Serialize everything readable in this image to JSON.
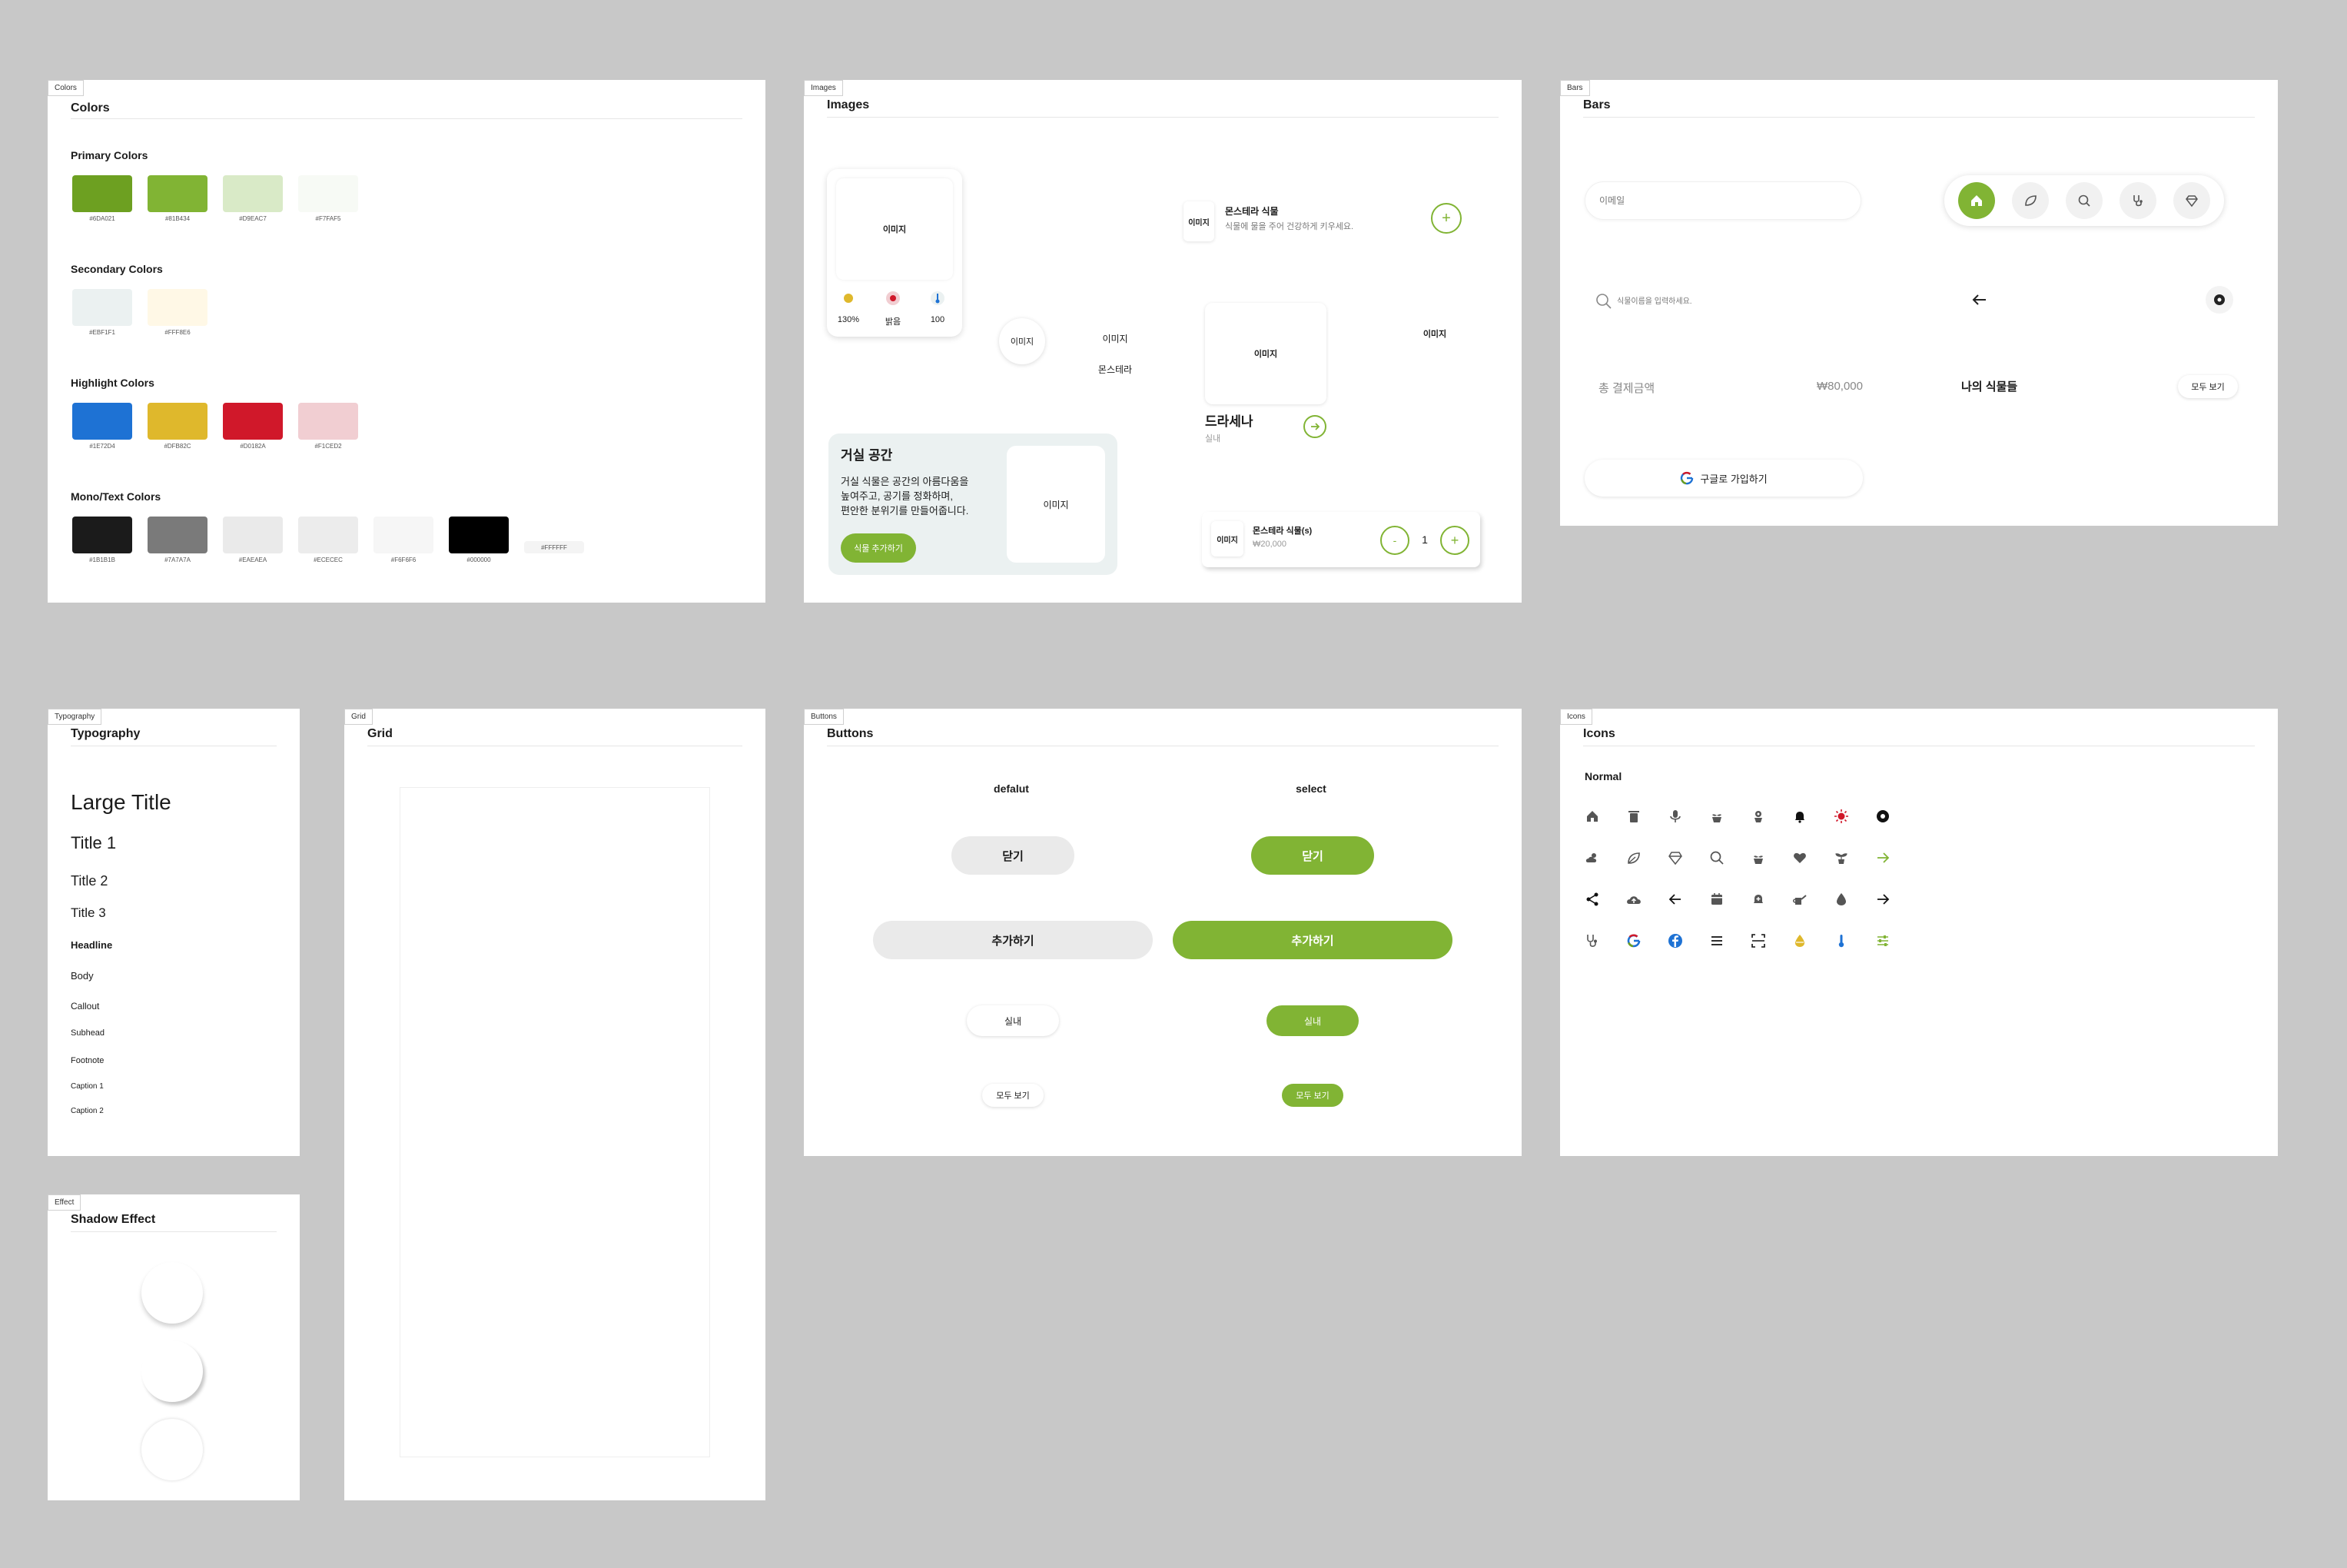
{
  "colors_frame": {
    "tag": "Colors",
    "title": "Colors",
    "groups": [
      {
        "title": "Primary Colors",
        "swatches": [
          {
            "hex": "#6DA021",
            "label": "#6DA021"
          },
          {
            "hex": "#81B434",
            "label": "#81B434"
          },
          {
            "hex": "#D9EAC7",
            "label": "#D9EAC7"
          },
          {
            "hex": "#F7FAF5",
            "label": "#F7FAF5"
          }
        ]
      },
      {
        "title": "Secondary Colors",
        "swatches": [
          {
            "hex": "#EBF1F1",
            "label": "#EBF1F1"
          },
          {
            "hex": "#FFF8E6",
            "label": "#FFF8E6"
          }
        ]
      },
      {
        "title": "Highlight Colors",
        "swatches": [
          {
            "hex": "#1E72D4",
            "label": "#1E72D4"
          },
          {
            "hex": "#DFB82C",
            "label": "#DFB82C"
          },
          {
            "hex": "#D0182A",
            "label": "#D0182A"
          },
          {
            "hex": "#F1CED2",
            "label": "#F1CED2"
          }
        ]
      },
      {
        "title": "Mono/Text Colors",
        "swatches": [
          {
            "hex": "#1B1B1B",
            "label": "#1B1B1B"
          },
          {
            "hex": "#7A7A7A",
            "label": "#7A7A7A"
          },
          {
            "hex": "#EAEAEA",
            "label": "#EAEAEA"
          },
          {
            "hex": "#ECECEC",
            "label": "#ECECEC"
          },
          {
            "hex": "#F6F6F6",
            "label": "#F6F6F6"
          },
          {
            "hex": "#000000",
            "label": "#000000"
          },
          {
            "hex": "#FFFFFF",
            "label": "#FFFFFF"
          }
        ]
      }
    ]
  },
  "images_frame": {
    "tag": "Images",
    "title": "Images",
    "plant_card": {
      "image_label": "이미지",
      "stats": [
        {
          "icon": "sun-icon",
          "value": "130%"
        },
        {
          "icon": "light-icon",
          "value": "밝음"
        },
        {
          "icon": "thermometer-icon",
          "value": "100"
        }
      ]
    },
    "circle_image": "이미지",
    "small_image": "이미지",
    "small_caption": "몬스테라",
    "list_item": {
      "image": "이미지",
      "title": "몬스테라 식물",
      "subtitle": "식물에 물을 주어 건강하게 키우세요."
    },
    "product": {
      "image": "이미지",
      "name": "드라세나",
      "category": "실내"
    },
    "right_image": "이미지",
    "room_card": {
      "title": "거실 공간",
      "desc1": "거실 식물은 공간의 아름다움을",
      "desc2": "높여주고, 공기를 정화하며,",
      "desc3": "편안한 분위기를 만들어줍니다.",
      "button": "식물 추가하기",
      "image": "이미지"
    },
    "cart_item": {
      "image": "이미지",
      "title": "몬스테라 식물(s)",
      "price": "₩20,000",
      "minus": "-",
      "qty": "1",
      "plus": "+"
    }
  },
  "bars_frame": {
    "tag": "Bars",
    "title": "Bars",
    "email_placeholder": "이메일",
    "search_placeholder": "식물이름을 입력하세요.",
    "total_label": "총 결제금액",
    "total_value": "₩80,000",
    "my_plants": "나의 식물들",
    "view_all": "모두 보기",
    "google_signup": "구글로 가입하기",
    "nav_icons": [
      "home-icon",
      "leaf-icon",
      "search-icon",
      "stethoscope-icon",
      "diamond-icon"
    ]
  },
  "typography_frame": {
    "tag": "Typography",
    "title": "Typography",
    "styles": [
      "Large Title",
      "Title 1",
      "Title 2",
      "Title 3",
      "Headline",
      "Body",
      "Callout",
      "Subhead",
      "Footnote",
      "Caption 1",
      "Caption 2"
    ]
  },
  "grid_frame": {
    "tag": "Grid",
    "title": "Grid"
  },
  "effect_frame": {
    "tag": "Effect",
    "title": "Shadow Effect"
  },
  "buttons_frame": {
    "tag": "Buttons",
    "title": "Buttons",
    "col_default": "defalut",
    "col_select": "select",
    "close": "닫기",
    "add": "추가하기",
    "indoor": "실내",
    "view_all": "모두 보기"
  },
  "icons_frame": {
    "tag": "Icons",
    "title": "Icons",
    "section": "Normal",
    "accent": "#81B434"
  }
}
